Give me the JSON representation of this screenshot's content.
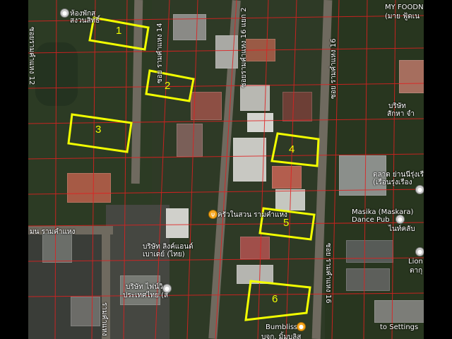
{
  "plots": [
    {
      "number": "1"
    },
    {
      "number": "2"
    },
    {
      "number": "3"
    },
    {
      "number": "4"
    },
    {
      "number": "5"
    },
    {
      "number": "6"
    }
  ],
  "streets": {
    "ramkhamhaeng_14": "ซอย รามคำแหง 14",
    "ramkhamhaeng_12": "ซอยรามคำแหง 12",
    "ramkhamhaeng_16_2": "ซอยรามคำแหง 16 แยก 2",
    "ramkhamhaeng_16_top": "ซอย รามคำแหง 16",
    "ramkhamhaeng_16_bottom": "ซอย รามคำแหง 16",
    "bottom_left_vert": "รามคำแหง",
    "ramkhamhaeng_left": "มน รามคำแหง"
  },
  "places": {
    "shop_top_left": [
      "ห้องพักสุ",
      "สงวนสิทธิ์"
    ],
    "my_foodnet": [
      "MY FOODNE",
      "(มาย ฟู้ดเน"
    ],
    "company_right": [
      "บริษัท",
      "สักหา จำ"
    ],
    "thai_right": [
      "ตลาด ย่านนีรุ่งเรือง",
      "(เรือนรุ่งเรือง"
    ],
    "khrua_nai_suan": "ครัวในสวน รามคำแหง",
    "masika_1": "Masika (Maskara)",
    "masika_2": "Dance Pub",
    "masika_sub": "ไนท์คลับ",
    "lion_1": "Lion",
    "lion_2": "ตากุ",
    "thai_mid_1": "บริษัท ลิงค์แอนด์",
    "thai_mid_2": "เบาเดย์ (ไทย)",
    "thai_low_1": "บริษัท ไฟน์วิก",
    "thai_low_2": "ประเทศไทย (ส",
    "bumbliss": "Bumbliss",
    "bottom_thai": "บจก. มิ้มบลิส",
    "settings": "to Settings"
  },
  "icons": {
    "pin_gray": "gray-place-pin-icon",
    "pin_food": "restaurant-pin-icon",
    "pin_shop": "shopping-bag-pin-icon"
  },
  "colors": {
    "plot_outline": "#f2ff00",
    "parcel_lines": "#e02020"
  }
}
